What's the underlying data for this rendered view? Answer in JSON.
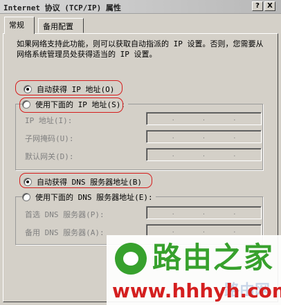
{
  "window": {
    "title": "Internet 协议 (TCP/IP) 属性",
    "help_label": "?",
    "close_label": "X"
  },
  "tabs": [
    {
      "label": "常规",
      "active": true
    },
    {
      "label": "备用配置",
      "active": false
    }
  ],
  "description": "如果网络支持此功能，则可以获取自动指派的 IP 设置。否则，您需要从网络系统管理员处获得适当的 IP 设置。",
  "ip": {
    "auto_label": "自动获得 IP 地址(O)",
    "auto_selected": true,
    "manual_label": "使用下面的 IP 地址(S):",
    "manual_selected": false,
    "fields": [
      {
        "label": "IP 地址(I):",
        "value": "."
      },
      {
        "label": "子网掩码(U):",
        "value": "."
      },
      {
        "label": "默认网关(D):",
        "value": "."
      }
    ]
  },
  "dns": {
    "auto_label": "自动获得 DNS 服务器地址(B)",
    "auto_selected": true,
    "manual_label": "使用下面的 DNS 服务器地址(E):",
    "manual_selected": false,
    "fields": [
      {
        "label": "首选 DNS 服务器(P):",
        "value": "."
      },
      {
        "label": "备用 DNS 服务器(A):",
        "value": "."
      }
    ]
  },
  "watermark": {
    "brand": "路由之家",
    "url": "www.hhhyh.com",
    "faint": "路由网"
  },
  "colors": {
    "dialog_bg": "#d4d0c8",
    "highlight": "#d61c1c",
    "brand_green": "#37a12d",
    "brand_red": "#d41f1f"
  }
}
